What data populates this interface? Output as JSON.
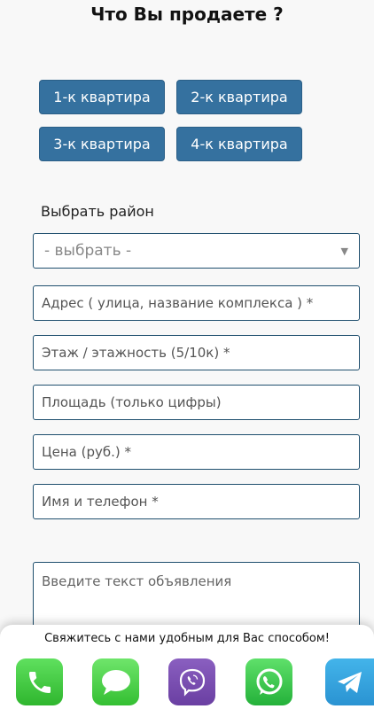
{
  "header": {
    "title": "Что Вы продаете ?"
  },
  "property_types": [
    {
      "label": "1-к квартира"
    },
    {
      "label": "2-к квартира"
    },
    {
      "label": "3-к квартира"
    },
    {
      "label": "4-к квартира"
    }
  ],
  "district": {
    "label": "Выбрать район",
    "selected": "- выбрать -"
  },
  "fields": {
    "address": {
      "placeholder": "Адрес ( улица, название комплекса ) *"
    },
    "floor": {
      "placeholder": "Этаж / этажность (5/10к) *"
    },
    "area": {
      "placeholder": "Площадь (только цифры)"
    },
    "price": {
      "placeholder": "Цена (руб.) *"
    },
    "contact": {
      "placeholder": "Имя и телефон *"
    },
    "ad_text": {
      "placeholder": "Введите текст объявления"
    }
  },
  "contact_bar": {
    "text": "Свяжитесь с нами удобным для Вас способом!",
    "apps": [
      {
        "icon": "phone-icon",
        "color": "#2fb62e"
      },
      {
        "icon": "sms-icon",
        "color": "#34bf32"
      },
      {
        "icon": "viber-icon",
        "color": "#6a3fa2"
      },
      {
        "icon": "whatsapp-icon",
        "color": "#24b13a"
      },
      {
        "icon": "telegram-icon",
        "color": "#2a93d2"
      }
    ]
  },
  "colors": {
    "button": "#35719f",
    "border": "#1f4f6e",
    "background": "#f8f8f8"
  }
}
